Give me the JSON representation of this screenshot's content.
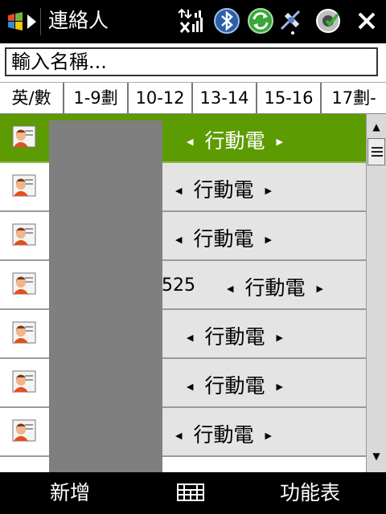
{
  "titlebar": {
    "title": "連絡人",
    "icons": [
      "windows-start-icon",
      "signal-data-icon",
      "bluetooth-icon",
      "sync-icon",
      "antenna-icon",
      "volume-icon",
      "close-icon"
    ]
  },
  "search": {
    "value": "輸入名稱..."
  },
  "tabs": [
    {
      "label": "英/數"
    },
    {
      "label": "1-9劃"
    },
    {
      "label": "10-12"
    },
    {
      "label": "13-14"
    },
    {
      "label": "15-16"
    },
    {
      "label": "17劃-"
    }
  ],
  "contacts": [
    {
      "number": "",
      "phone_type": "行動電",
      "selected": true
    },
    {
      "number": "",
      "phone_type": "行動電",
      "selected": false
    },
    {
      "number": "",
      "phone_type": "行動電",
      "selected": false
    },
    {
      "number": "525",
      "phone_type": "行動電",
      "selected": false
    },
    {
      "number": "",
      "phone_type": "行動電",
      "selected": false
    },
    {
      "number": "",
      "phone_type": "行動電",
      "selected": false
    },
    {
      "number": "",
      "phone_type": "行動電",
      "selected": false
    }
  ],
  "softkeys": {
    "left": "新增",
    "right": "功能表"
  },
  "colors": {
    "selection": "#5d9b03",
    "bar": "#000000",
    "redaction": "#7f7f7f"
  }
}
